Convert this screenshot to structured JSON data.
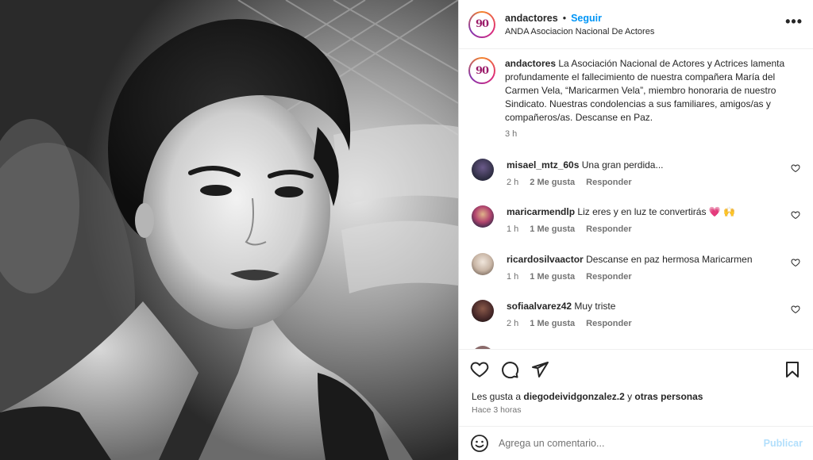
{
  "header": {
    "username": "andactores",
    "separator": "•",
    "follow_label": "Seguir",
    "subtitle": "ANDA Asociacion Nacional De Actores",
    "more_label": "•••"
  },
  "avatar_logo": "90",
  "caption": {
    "username": "andactores",
    "text": "La Asociación Nacional de Actores y Actrices lamenta profundamente el fallecimiento de nuestra compañera María del Carmen Vela, “Maricarmen Vela”, miembro honoraria de nuestro Sindicato. Nuestras condolencias a sus familiares, amigos/as y compañeros/as. Descanse en Paz.",
    "time": "3 h"
  },
  "comments": [
    {
      "username": "misael_mtz_60s",
      "text": "Una gran perdida...",
      "time": "2 h",
      "likes": "2 Me gusta",
      "reply": "Responder"
    },
    {
      "username": "maricarmendlp",
      "text": "Liz eres y en luz te convertirás 💗 🙌",
      "time": "1 h",
      "likes": "1 Me gusta",
      "reply": "Responder"
    },
    {
      "username": "ricardosilvaactor",
      "text": "Descanse en paz hermosa Maricarmen",
      "time": "1 h",
      "likes": "1 Me gusta",
      "reply": "Responder"
    },
    {
      "username": "sofiaalvarez42",
      "text": "Muy triste",
      "time": "2 h",
      "likes": "1 Me gusta",
      "reply": "Responder"
    }
  ],
  "icons": {
    "like": "heart-icon",
    "comment": "comment-bubble-icon",
    "share": "paper-plane-icon",
    "save": "bookmark-icon",
    "emoji": "smiley-icon",
    "more": "more-options-icon"
  },
  "likes": {
    "prefix": "Les gusta a ",
    "user": "diegodeividgonzalez.2",
    "middle": " y ",
    "others": "otras personas"
  },
  "posted_ago": "Hace 3 horas",
  "comment_box": {
    "placeholder": "Agrega un comentario...",
    "publish_label": "Publicar"
  },
  "colors": {
    "link_blue": "#0095f6",
    "publish_disabled": "#b2dffc",
    "muted": "#737373",
    "text": "#262626"
  }
}
